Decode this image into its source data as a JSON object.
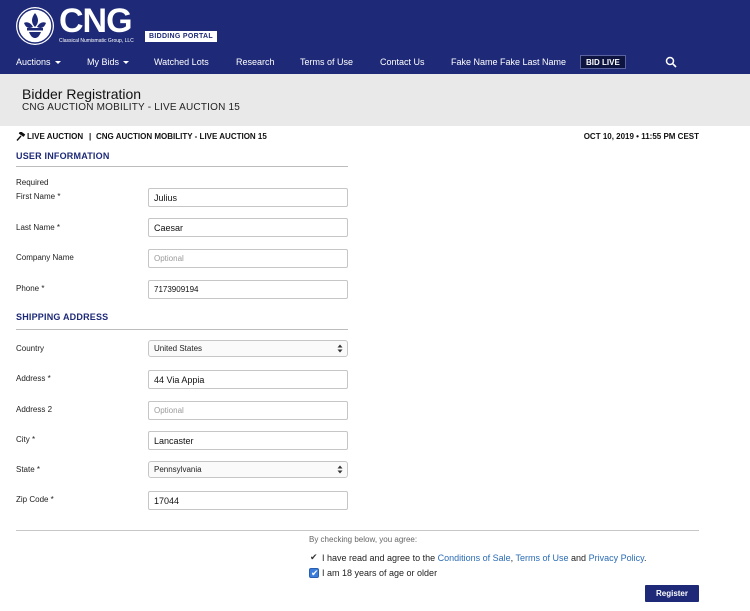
{
  "header": {
    "logo_text": "CNG",
    "logo_subtext": "Classical Numismatic Group, LLC",
    "portal_badge": "BIDDING PORTAL",
    "nav": {
      "auctions": "Auctions",
      "my_bids": "My Bids",
      "watched_lots": "Watched Lots",
      "research": "Research",
      "terms_of_use": "Terms of Use",
      "contact_us": "Contact Us",
      "user_name": "Fake Name Fake Last Name",
      "bid_live": "BID LIVE"
    },
    "icons": {
      "logo": "fleur-emblem-icon",
      "search": "search-icon",
      "dropdown": "caret-down-icon"
    }
  },
  "title_band": {
    "title": "Bidder Registration",
    "subtitle": "CNG AUCTION MOBILITY  - LIVE AUCTION 15"
  },
  "live_bar": {
    "label": "LIVE AUCTION",
    "separator": "|",
    "auction_name": "CNG AUCTION MOBILITY - LIVE AUCTION 15",
    "datetime": "OCT 10, 2019 • 11:55 PM CEST",
    "icon": "gavel-icon"
  },
  "user_information": {
    "heading": "USER INFORMATION",
    "required_note": "Required",
    "first_name": {
      "label": "First Name *",
      "value": "Julius"
    },
    "last_name": {
      "label": "Last Name *",
      "value": "Caesar"
    },
    "company_name": {
      "label": "Company Name",
      "placeholder": "Optional"
    },
    "phone": {
      "label": "Phone *",
      "value": "7173909194"
    }
  },
  "shipping_address": {
    "heading": "SHIPPING ADDRESS",
    "country": {
      "label": "Country",
      "selected": "United States"
    },
    "address": {
      "label": "Address *",
      "value": "44 Via Appia"
    },
    "address2": {
      "label": "Address 2",
      "placeholder": "Optional"
    },
    "city": {
      "label": "City *",
      "value": "Lancaster"
    },
    "state": {
      "label": "State *",
      "selected": "Pennsylvania"
    },
    "zip": {
      "label": "Zip Code *",
      "value": "17044"
    }
  },
  "agreement": {
    "intro": "By checking below, you agree:",
    "terms_prefix": "I have read and agree to the",
    "conditions_link": "Conditions of Sale",
    "comma": ",",
    "terms_link": "Terms of Use",
    "and_text": "and",
    "privacy_link": "Privacy Policy",
    "period": ".",
    "age_text": "I am 18 years of age or older",
    "check_glyph": "✔"
  },
  "register_label": "Register",
  "colors": {
    "brand": "#1e2a78",
    "link": "#2a6bb5",
    "checkbox_checked": "#3b7ddd"
  }
}
